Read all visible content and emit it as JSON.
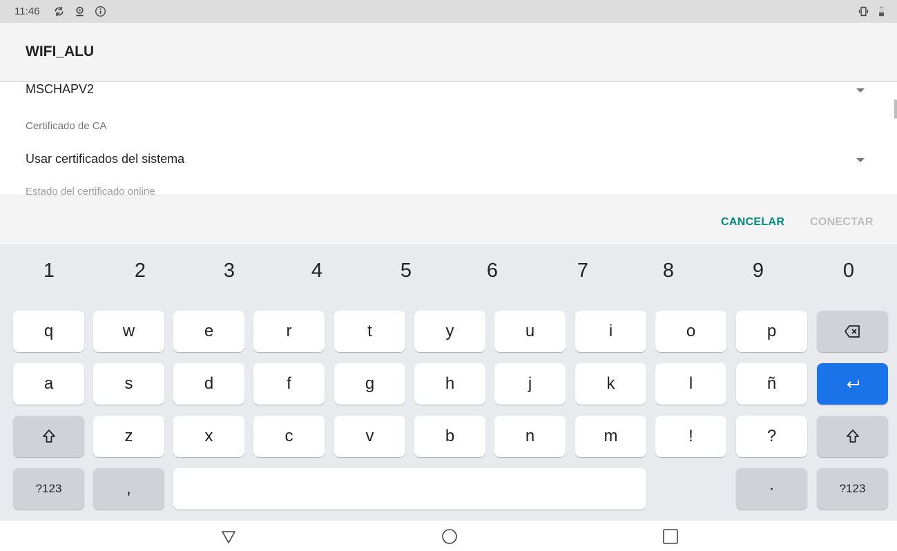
{
  "status_bar": {
    "time": "11:46",
    "icons": [
      "sync-icon",
      "location-icon",
      "info-icon",
      "vibrate-icon",
      "battery-icon"
    ]
  },
  "dialog": {
    "title": "WIFI_ALU",
    "fields": {
      "phase2_value": "MSCHAPV2",
      "ca_label": "Certificado de CA",
      "ca_value": "Usar certificados del sistema",
      "next_label_clipped": "Estado del certificado online"
    },
    "actions": {
      "cancel": "CANCELAR",
      "connect": "CONECTAR"
    }
  },
  "keyboard": {
    "number_row": [
      "1",
      "2",
      "3",
      "4",
      "5",
      "6",
      "7",
      "8",
      "9",
      "0"
    ],
    "row1": [
      "q",
      "w",
      "e",
      "r",
      "t",
      "y",
      "u",
      "i",
      "o",
      "p"
    ],
    "row2": [
      "a",
      "s",
      "d",
      "f",
      "g",
      "h",
      "j",
      "k",
      "l",
      "ñ"
    ],
    "row3": [
      "z",
      "x",
      "c",
      "v",
      "b",
      "n",
      "m",
      "!",
      "?"
    ],
    "symbols_key": "?123",
    "comma_key": ",",
    "period_key": "·",
    "symbols_key_right": "?123",
    "colors": {
      "enter": "#1a73e8",
      "accent": "#00897b"
    }
  },
  "nav_bar": {
    "buttons": [
      "back-icon",
      "home-icon",
      "recents-icon"
    ]
  }
}
